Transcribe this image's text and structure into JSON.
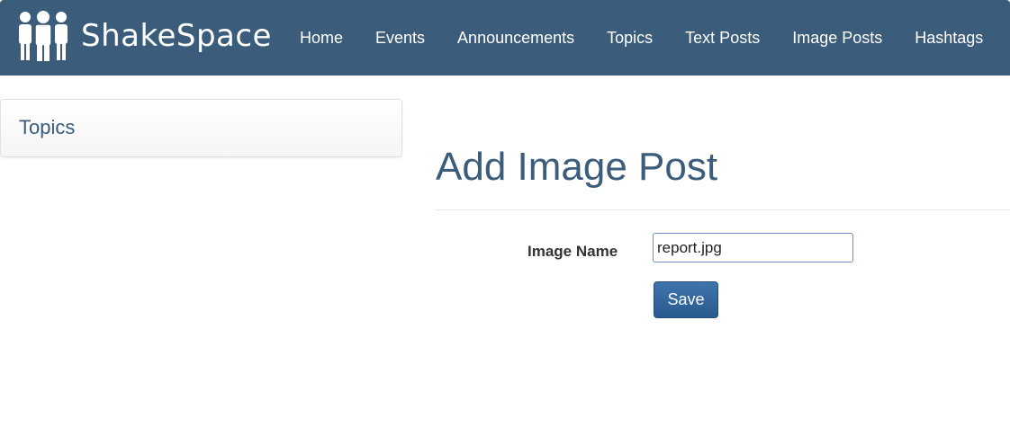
{
  "brand": {
    "name": "ShakeSpace",
    "logo_icon": "people-group-icon"
  },
  "nav": {
    "items": [
      {
        "label": "Home"
      },
      {
        "label": "Events"
      },
      {
        "label": "Announcements"
      },
      {
        "label": "Topics"
      },
      {
        "label": "Text Posts"
      },
      {
        "label": "Image Posts"
      },
      {
        "label": "Hashtags"
      }
    ]
  },
  "sidebar": {
    "panel_title": "Topics"
  },
  "main": {
    "title": "Add Image Post",
    "form": {
      "image_name_label": "Image Name",
      "image_name_value": "report.jpg",
      "save_label": "Save"
    }
  },
  "colors": {
    "navbar": "#3b5c7a",
    "accent": "#3b5c7a",
    "button": "#2f6399"
  }
}
